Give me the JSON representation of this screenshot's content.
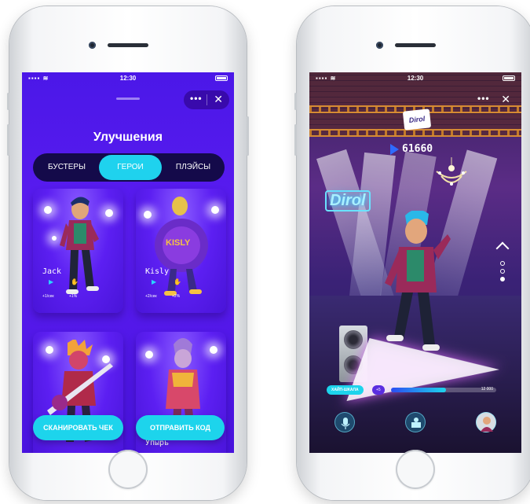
{
  "status_bar": {
    "time": "12:30",
    "signal": "▪▪▪▪ ≋"
  },
  "left_screen": {
    "menu_dots": "•••",
    "close": "✕",
    "title": "Улучшения",
    "tabs": [
      {
        "label": "БУСТЕРЫ",
        "active": false
      },
      {
        "label": "ГЕРОИ",
        "active": true
      },
      {
        "label": "ПЛЭЙСЫ",
        "active": false
      }
    ],
    "cards": [
      {
        "name": "Jack",
        "stat_1": "+1/сек",
        "stat_2": "+1%"
      },
      {
        "name": "Kisly",
        "stat_1": "+2/сек",
        "stat_2": "+2%"
      },
      {
        "name": "",
        "stat_1": "",
        "stat_2": ""
      },
      {
        "name": "Упырь",
        "stat_1": "",
        "stat_2": ""
      }
    ],
    "buttons": {
      "scan": "СКАНИРОВАТЬ ЧЕК",
      "send": "ОТПРАВИТЬ КОД"
    }
  },
  "right_screen": {
    "menu_dots": "•••",
    "close": "✕",
    "brand_badge": "Dirol",
    "neon_sign": "Dirol",
    "score": "61660",
    "hype": {
      "label": "ХАЙП-ШКАЛА",
      "bonus": "+5",
      "max": "12 000",
      "fill_fraction": 0.52
    },
    "pager": {
      "active_index": 2,
      "count": 3
    }
  },
  "colors": {
    "accent": "#1dd4ec",
    "purple": "#5a1cf0",
    "tab_bg": "#140a4a"
  }
}
